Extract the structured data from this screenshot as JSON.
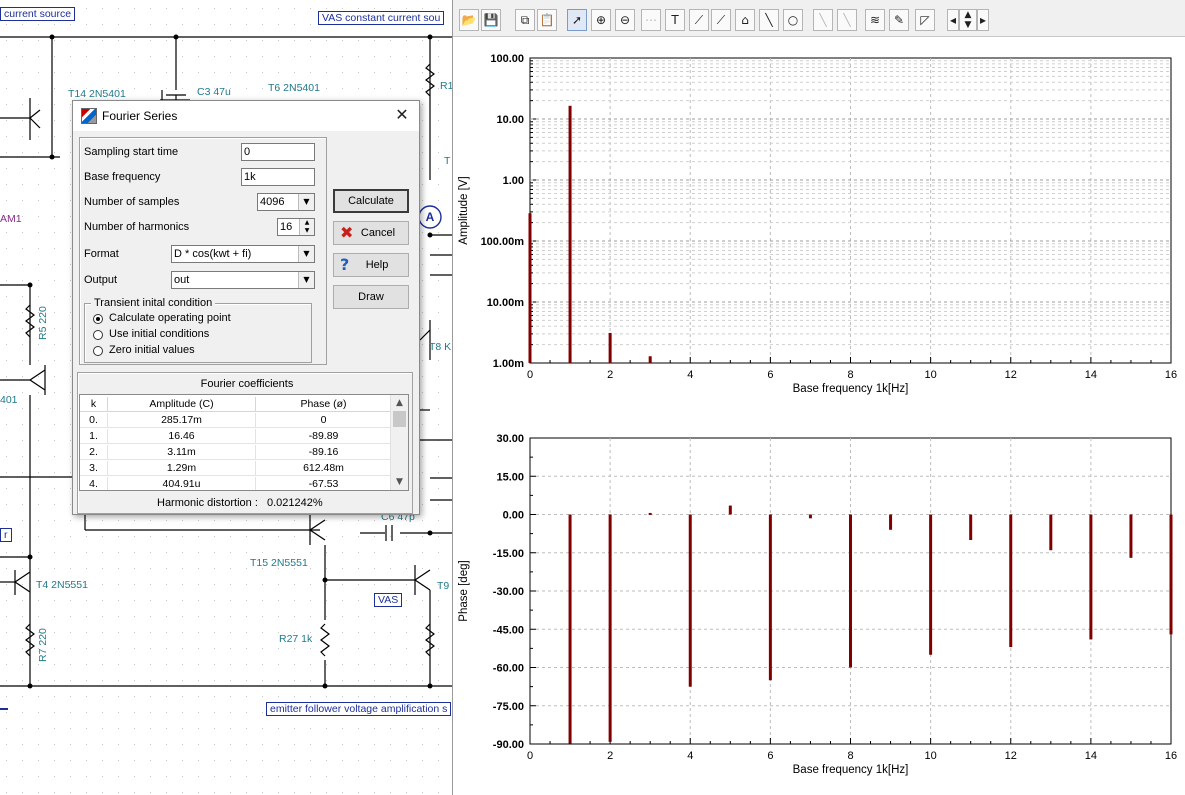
{
  "schematic": {
    "labels": {
      "t14": "T14 2N5401",
      "c3": "C3 47u",
      "t6": "T6 2N5401",
      "r1": "R1",
      "t_partial": "T",
      "am1": "AM1",
      "t8": "T8 K",
      "r5": "R5 220",
      "q401": "401",
      "c6": "C6 47p",
      "t15": "T15 2N5551",
      "t9": "T9",
      "t4": "T4 2N5551",
      "r27": "R27 1k",
      "r7": "R7 220"
    },
    "boxes": {
      "current_source": "current source",
      "vas_cs": "VAS constant current sou",
      "r_box": "r",
      "vas": "VAS",
      "emitter_follower": "emitter follower voltage amplification s"
    },
    "ammeter_symbol": "A"
  },
  "dialog": {
    "title": "Fourier Series",
    "close_glyph": "✕",
    "fields": {
      "sampling_start_time": {
        "label": "Sampling start time",
        "value": "0"
      },
      "base_frequency": {
        "label": "Base frequency",
        "value": "1k"
      },
      "number_of_samples": {
        "label": "Number of samples",
        "value": "4096"
      },
      "number_of_harmonics": {
        "label": "Number of harmonics",
        "value": "16"
      },
      "format": {
        "label": "Format",
        "value": "D * cos(kwt + fi)"
      },
      "output": {
        "label": "Output",
        "value": "out"
      }
    },
    "transient": {
      "legend": "Transient inital condition",
      "options": [
        {
          "label": "Calculate operating point",
          "selected": true
        },
        {
          "label": "Use initial conditions",
          "selected": false
        },
        {
          "label": "Zero initial values",
          "selected": false
        }
      ]
    },
    "buttons": {
      "calculate": "Calculate",
      "cancel": "Cancel",
      "help": "Help",
      "draw": "Draw"
    },
    "coefficients": {
      "title": "Fourier coefficients",
      "headers": [
        "k",
        "Amplitude (C)",
        "Phase (ø)"
      ],
      "rows": [
        [
          "0.",
          "285.17m",
          "0"
        ],
        [
          "1.",
          "16.46",
          "-89.89"
        ],
        [
          "2.",
          "3.11m",
          "-89.16"
        ],
        [
          "3.",
          "1.29m",
          "612.48m"
        ],
        [
          "4.",
          "404.91u",
          "-67.53"
        ]
      ],
      "scroll_up": "▲",
      "scroll_down": "▼"
    },
    "distortion_label": "Harmonic distortion :",
    "distortion_value": "0.021242%"
  },
  "toolbar": {
    "icons": [
      "open-icon",
      "save-icon",
      "copy-icon",
      "paste-icon",
      "pointer-icon",
      "zoom-in-icon",
      "zoom-out-icon",
      "grid-icon",
      "text-icon",
      "cursor-a-icon",
      "cursor-b-icon",
      "marker-icon",
      "line-icon",
      "circle-icon",
      "curve-a-icon",
      "curve-b-icon",
      "waveform-icon",
      "probe-icon",
      "ramp-icon",
      "prev-icon",
      "updown-icon",
      "next-icon"
    ]
  },
  "chart_data": [
    {
      "type": "bar",
      "xlabel": "Base frequency 1k[Hz]",
      "ylabel": "Amplitude [V]",
      "xlim": [
        0,
        16
      ],
      "xticks": [
        "0",
        "2",
        "4",
        "6",
        "8",
        "10",
        "12",
        "14",
        "16"
      ],
      "yscale": "log",
      "ylim": [
        0.001,
        100
      ],
      "yticks": [
        "1.00m",
        "10.00m",
        "100.00m",
        "1.00",
        "10.00",
        "100.00"
      ],
      "grid": true,
      "color": "#800000",
      "x": [
        0,
        1,
        2,
        3,
        4
      ],
      "values": [
        0.28517,
        16.46,
        0.00311,
        0.00129,
        0.00040491
      ]
    },
    {
      "type": "bar",
      "xlabel": "Base frequency 1k[Hz]",
      "ylabel": "Phase [deg]",
      "xlim": [
        0,
        16
      ],
      "xticks": [
        "0",
        "2",
        "4",
        "6",
        "8",
        "10",
        "12",
        "14",
        "16"
      ],
      "ylim": [
        -90,
        30
      ],
      "yticks": [
        "-90.00",
        "-75.00",
        "-60.00",
        "-45.00",
        "-30.00",
        "-15.00",
        "0.00",
        "15.00",
        "30.00"
      ],
      "grid": true,
      "color": "#800000",
      "x": [
        1,
        2,
        3,
        4,
        5,
        6,
        7,
        8,
        9,
        10,
        11,
        12,
        13,
        14,
        15,
        16
      ],
      "values": [
        -89.89,
        -89.16,
        0.61248,
        -67.53,
        3.5,
        -65,
        -1.5,
        -60,
        -6,
        -55,
        -10,
        -52,
        -14,
        -49,
        -17,
        -47
      ]
    }
  ]
}
